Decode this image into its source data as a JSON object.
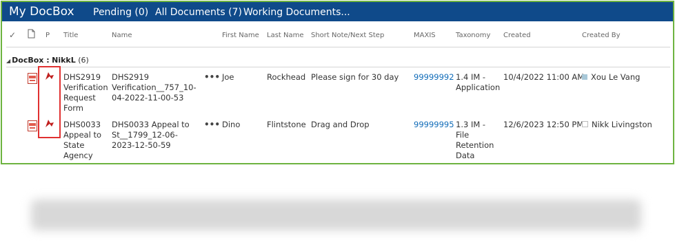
{
  "header": {
    "title": "My DocBox",
    "nav": [
      "Pending (0)",
      "All Documents (7)",
      "Working Documents..."
    ]
  },
  "columns": {
    "check": "✓",
    "p": "P",
    "title": "Title",
    "name": "Name",
    "first_name": "First Name",
    "last_name": "Last Name",
    "short_note": "Short Note/Next Step",
    "maxis": "MAXIS",
    "taxonomy": "Taxonomy",
    "created": "Created",
    "created_by": "Created By"
  },
  "group": {
    "prefix": "DocBox :",
    "name": "NikkL",
    "count": "(6)"
  },
  "rows": [
    {
      "title_lines": [
        "DHS2919",
        "Verification",
        "Request",
        "Form"
      ],
      "name_lines": [
        "DHS2919",
        "Verification__757_10-",
        "04-2022-11-00-53"
      ],
      "menu": "•••",
      "first_name": "Joe",
      "last_name": "Rockhead",
      "short_note": "Please sign for 30 day",
      "maxis": "99999992",
      "taxonomy_lines": [
        "1.4 IM -",
        "Application"
      ],
      "created": "10/4/2022 11:00 AM",
      "created_by": "Xou Le Vang",
      "presence_color": "#a8c8d8"
    },
    {
      "title_lines": [
        "DHS0033",
        "Appeal to",
        "State",
        "Agency"
      ],
      "name_lines": [
        "DHS0033 Appeal to",
        "St__1799_12-06-",
        "2023-12-50-59"
      ],
      "menu": "•••",
      "first_name": "Dino",
      "last_name": "Flintstone",
      "short_note": "Drag and Drop",
      "maxis": "99999995",
      "taxonomy_lines": [
        "1.3 IM -",
        "File",
        "Retention",
        "Data"
      ],
      "created": "12/6/2023 12:50 PM",
      "created_by": "Nikk Livingston",
      "presence_color": "#ffffff"
    }
  ],
  "colors": {
    "header_bg": "#0f4a8a",
    "frame_border": "#6db33f",
    "flag": "#c0201f",
    "highlight_box": "#e03030",
    "link": "#0f6bb8"
  }
}
